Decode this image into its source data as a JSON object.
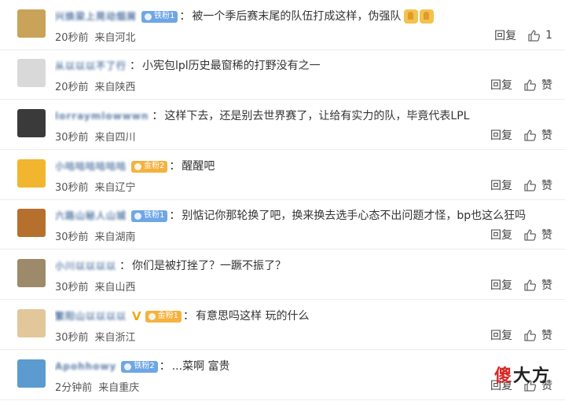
{
  "comments": [
    {
      "username": "兴焕梁上晃动烟屑",
      "badge": "铁粉1",
      "badge_color": "#6fa6e6",
      "badge_style": "blue",
      "text": "被一个季后赛末尾的队伍打成这样，伪强队",
      "thumbs": true,
      "time": "20秒前",
      "source": "来自河北",
      "reply": "回复",
      "like": "1",
      "avatar_color": "#c9a35a"
    },
    {
      "username": "从以以以不了行",
      "badge": "",
      "badge_style": "",
      "text": "小宪包lpl历史最窗稀的打野没有之一",
      "time": "20秒前",
      "source": "来自陕西",
      "reply": "回复",
      "like": "赞",
      "avatar_color": "#d9d9d9"
    },
    {
      "username": "lorraymlowwwn",
      "badge": "",
      "badge_style": "",
      "text": "这样下去，还是别去世界赛了，让给有实力的队，毕竟代表LPL",
      "time": "30秒前",
      "source": "来自四川",
      "reply": "回复",
      "like": "赞",
      "avatar_color": "#3a3a3a"
    },
    {
      "username": "小咕咕咕咕咕咕",
      "badge": "金粉2",
      "badge_style": "gold",
      "text": "醒醒吧",
      "time": "30秒前",
      "source": "来自辽宁",
      "reply": "回复",
      "like": "赞",
      "avatar_color": "#f2b530"
    },
    {
      "username": "六路山秘人山城",
      "badge": "铁粉1",
      "badge_style": "blue",
      "text": "别惦记你那轮换了吧，换来换去选手心态不出问题才怪，bp也这么狂吗",
      "time": "30秒前",
      "source": "来自湖南",
      "reply": "回复",
      "like": "赞",
      "avatar_color": "#b5702e"
    },
    {
      "username": "小川以以以以",
      "badge": "",
      "badge_style": "",
      "text": "你们是被打挫了？一蹶不振了？",
      "time": "30秒前",
      "source": "来自山西",
      "reply": "回复",
      "like": "赞",
      "avatar_color": "#9c8a6a"
    },
    {
      "username": "繁阳山以以以以",
      "vip": "V",
      "badge": "金粉1",
      "badge_style": "gold",
      "text": "有意思吗这样 玩的什么",
      "time": "30秒前",
      "source": "来自浙江",
      "reply": "回复",
      "like": "赞",
      "avatar_color": "#e2c79a"
    },
    {
      "username": "Apohhowy",
      "badge": "铁粉2",
      "badge_style": "blue",
      "text": "...菜啊 富贵",
      "time": "2分钟前",
      "source": "来自重庆",
      "reply": "回复",
      "like": "赞",
      "avatar_color": "#5b9bd0"
    }
  ],
  "watermark": {
    "first": "傻",
    "rest": "大方"
  }
}
